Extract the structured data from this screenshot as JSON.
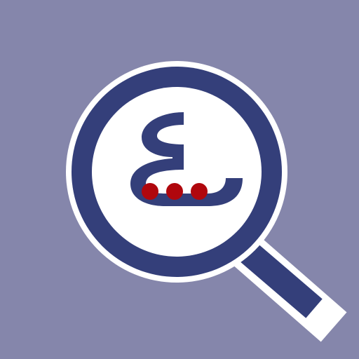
{
  "app_icon": {
    "icon_name": "magnifier-arabic-letter-icon",
    "colors": {
      "background": "#8586ab",
      "primary": "#343f7a",
      "outline": "#ffffff",
      "lens": "#ffffff",
      "dots": "#b0070d"
    },
    "dots": [
      {
        "name": "dot-1"
      },
      {
        "name": "dot-2"
      },
      {
        "name": "dot-3"
      }
    ]
  }
}
